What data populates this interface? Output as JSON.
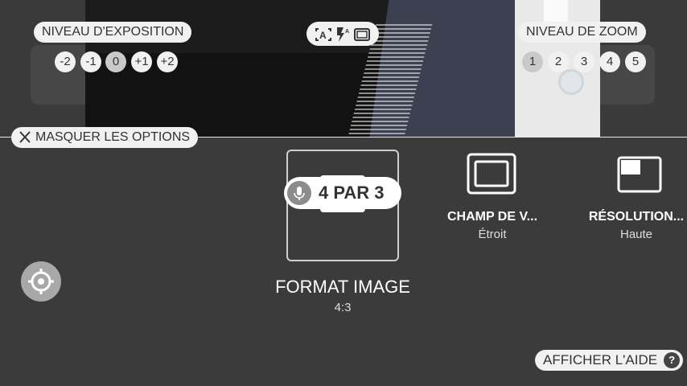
{
  "exposure": {
    "title": "NIVEAU D'EXPOSITION",
    "levels": [
      "-2",
      "-1",
      "0",
      "+1",
      "+2"
    ],
    "selected": "0"
  },
  "zoom": {
    "title": "NIVEAU DE ZOOM",
    "levels": [
      "1",
      "2",
      "3",
      "4",
      "5"
    ]
  },
  "top_icons": [
    "auto-text-icon",
    "flash-auto-icon",
    "frame-icon"
  ],
  "hide_options": {
    "label": "MASQUER LES OPTIONS"
  },
  "format": {
    "title": "FORMAT IMAGE",
    "value": "4:3",
    "voice_label": "4 PAR 3"
  },
  "field": {
    "title": "CHAMP DE V...",
    "value": "Étroit"
  },
  "resolution": {
    "title": "RÉSOLUTION...",
    "value": "Haute"
  },
  "help": {
    "label": "AFFICHER L'AIDE",
    "icon_text": "?"
  }
}
